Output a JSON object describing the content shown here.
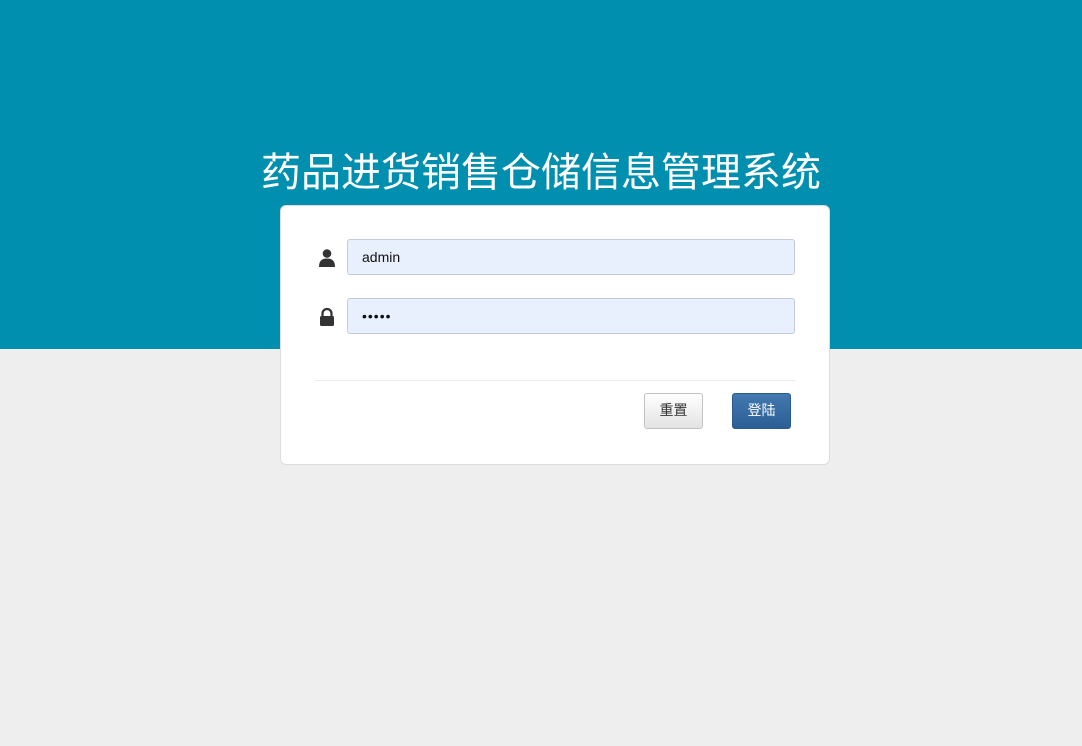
{
  "page": {
    "title": "药品进货销售仓储信息管理系统",
    "band_color": "#008faf",
    "background_color": "#eeeeee"
  },
  "login_form": {
    "username": {
      "icon": "user-icon",
      "value": "admin"
    },
    "password": {
      "icon": "lock-icon",
      "masked_value": "•••••"
    },
    "buttons": {
      "reset_label": "重置",
      "login_label": "登陆"
    }
  }
}
